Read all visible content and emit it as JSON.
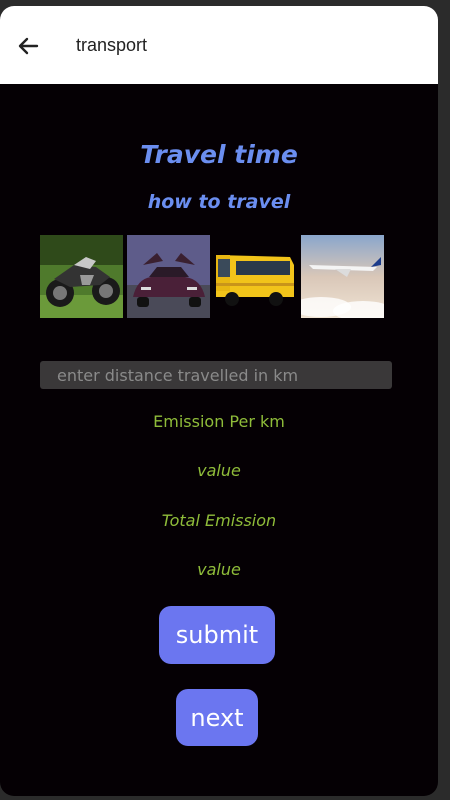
{
  "appbar": {
    "title": "transport",
    "back_icon": "arrow-left-icon"
  },
  "content": {
    "heading": "Travel time",
    "subheading": "how to travel",
    "transport_options": [
      {
        "name": "motorcycle",
        "icon": "motorcycle-image"
      },
      {
        "name": "car",
        "icon": "car-image"
      },
      {
        "name": "bus",
        "icon": "bus-image"
      },
      {
        "name": "airplane",
        "icon": "airplane-image"
      }
    ],
    "distance_input": {
      "placeholder": "enter distance travelled in km",
      "value": ""
    },
    "emission_per_km_label": "Emission Per km",
    "emission_per_km_value": "value",
    "total_emission_label": "Total Emission",
    "total_emission_value": "value",
    "submit_label": "submit",
    "next_label": "next"
  },
  "colors": {
    "background": "#050004",
    "heading": "#6b8ef0",
    "label": "#8fbc3a",
    "button": "#6b76f0"
  }
}
